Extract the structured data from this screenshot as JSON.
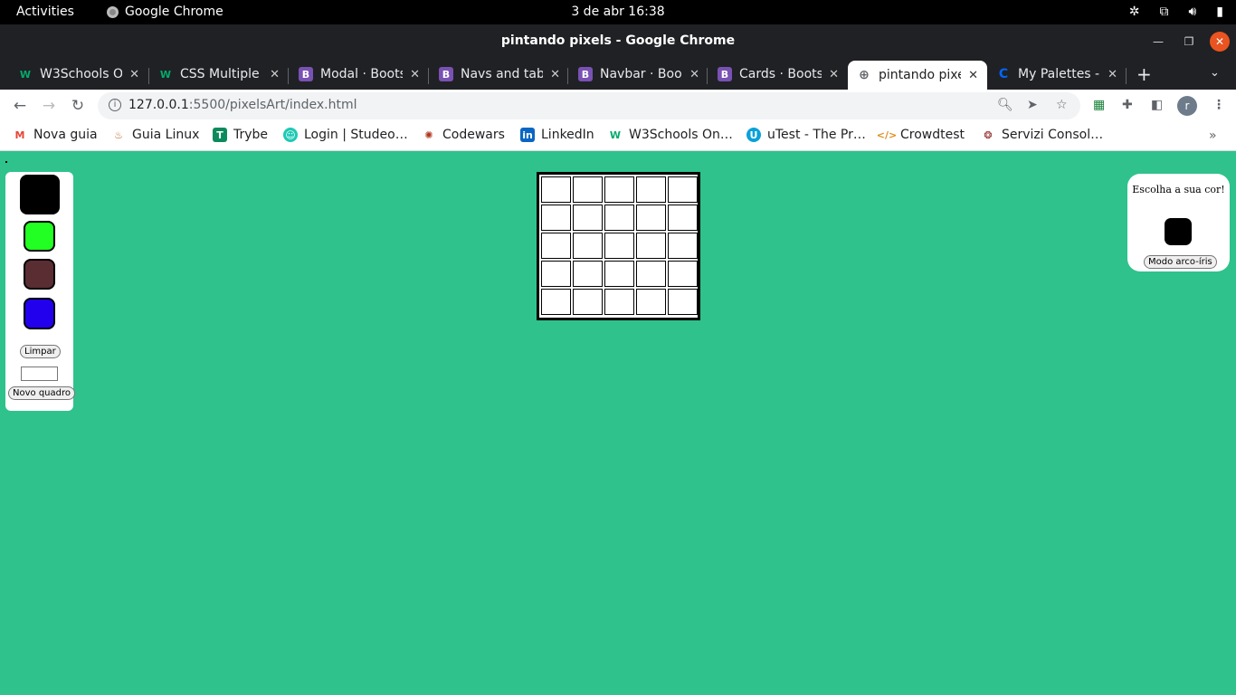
{
  "system": {
    "activities": "Activities",
    "app_name": "Google Chrome",
    "clock": "3 de abr  16:38"
  },
  "window": {
    "title": "pintando pixels - Google Chrome"
  },
  "tabs": [
    {
      "label": "W3Schools O",
      "favicon": "w3schools-icon",
      "active": false
    },
    {
      "label": "CSS Multiple I",
      "favicon": "w3schools-icon",
      "active": false
    },
    {
      "label": "Modal · Boots",
      "favicon": "bootstrap-icon",
      "active": false
    },
    {
      "label": "Navs and tab",
      "favicon": "bootstrap-icon",
      "active": false
    },
    {
      "label": "Navbar · Boot",
      "favicon": "bootstrap-icon",
      "active": false
    },
    {
      "label": "Cards · Boots",
      "favicon": "bootstrap-icon",
      "active": false
    },
    {
      "label": "pintando pixe",
      "favicon": "globe-icon",
      "active": true
    },
    {
      "label": "My Palettes -",
      "favicon": "coolors-icon",
      "active": false
    }
  ],
  "toolbar": {
    "url_host": "127.0.0.1",
    "url_rest": ":5500/pixelsArt/index.html",
    "profile_initial": "r"
  },
  "bookmarks": [
    {
      "label": "Nova guia",
      "icon": "gmail-icon"
    },
    {
      "label": "Guia Linux",
      "icon": "linux-icon"
    },
    {
      "label": "Trybe",
      "icon": "trybe-icon"
    },
    {
      "label": "Login | Studeo…",
      "icon": "studeo-icon"
    },
    {
      "label": "Codewars",
      "icon": "codewars-icon"
    },
    {
      "label": "LinkedIn",
      "icon": "linkedin-icon"
    },
    {
      "label": "W3Schools On…",
      "icon": "w3schools-icon"
    },
    {
      "label": "uTest - The Pr…",
      "icon": "utest-icon"
    },
    {
      "label": "Crowdtest",
      "icon": "crowdtest-icon"
    },
    {
      "label": "Servizi Consol…",
      "icon": "servizi-icon"
    }
  ],
  "palette": {
    "colors": [
      "#000000",
      "#22ff22",
      "#5a2d33",
      "#2200ee"
    ],
    "clear_label": "Limpar",
    "new_board_label": "Novo quadro"
  },
  "board": {
    "rows": 5,
    "cols": 5
  },
  "right_panel": {
    "prompt": "Escolha a sua cor!",
    "current_color": "#000000",
    "rainbow_label": "Modo arco-íris"
  },
  "colors": {
    "page_background": "#2fc28c"
  }
}
